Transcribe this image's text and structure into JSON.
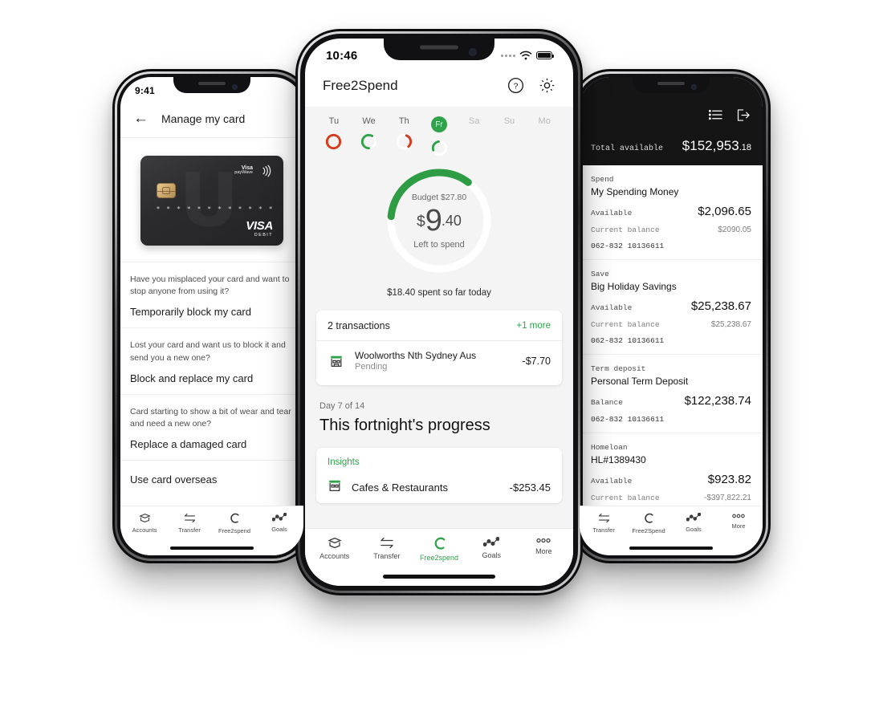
{
  "left_phone": {
    "status": {
      "time": "9:41"
    },
    "header": {
      "back_icon": "arrow-left-icon",
      "title": "Manage my card"
    },
    "card": {
      "brand_top": "Visa",
      "brand_top_sub": "payWave",
      "masked_number": "* * * *   * * * *   * * * *",
      "network": "VISA",
      "network_sub": "DEBIT",
      "logo_letter": "U"
    },
    "options": [
      {
        "question": "Have you misplaced your card and want to stop anyone from using it?",
        "action": "Temporarily block my card"
      },
      {
        "question": "Lost your card and want us to block it and send you a new one?",
        "action": "Block and replace my card"
      },
      {
        "question": "Card starting to show a bit of wear and tear and need a new one?",
        "action": "Replace a damaged card"
      }
    ],
    "simple_option": "Use card overseas",
    "tabs": [
      {
        "label": "Accounts",
        "icon": "accounts-icon",
        "active": false
      },
      {
        "label": "Transfer",
        "icon": "transfer-icon",
        "active": false
      },
      {
        "label": "Free2spend",
        "icon": "free2spend-icon",
        "active": false
      },
      {
        "label": "Goals",
        "icon": "goals-icon",
        "active": false
      }
    ]
  },
  "center_phone": {
    "status": {
      "time": "10:46",
      "wifi_icon": "wifi-icon",
      "battery_icon": "battery-icon"
    },
    "header": {
      "title": "Free2Spend",
      "help_icon": "help-circle-icon",
      "settings_icon": "gear-icon"
    },
    "days": [
      {
        "label": "Tu",
        "state": "past",
        "ring_color": "#d8391b",
        "ring_pct": 100
      },
      {
        "label": "We",
        "state": "past",
        "ring_color": "#2fa24a",
        "ring_pct": 58
      },
      {
        "label": "Th",
        "state": "past",
        "ring_color": "#d8391b",
        "ring_pct": 33
      },
      {
        "label": "Fr",
        "state": "active",
        "ring_color": "#2fa24a",
        "ring_pct": 28
      },
      {
        "label": "Sa",
        "state": "future",
        "ring_color": "",
        "ring_pct": 0
      },
      {
        "label": "Su",
        "state": "future",
        "ring_color": "",
        "ring_pct": 0
      },
      {
        "label": "Mo",
        "state": "future",
        "ring_color": "",
        "ring_pct": 0
      }
    ],
    "gauge": {
      "budget_label": "Budget $27.80",
      "currency": "$",
      "amount_major": "9",
      "amount_cents": ".40",
      "caption": "Left to spend",
      "percent": 34,
      "color": "#2e9c45",
      "track_color": "#ffffff"
    },
    "spent_today": "$18.40 spent so far today",
    "transactions_card": {
      "count_label": "2 transactions",
      "more_label": "+1 more",
      "rows": [
        {
          "icon": "store-icon",
          "name": "Woolworths Nth Sydney Aus",
          "status": "Pending",
          "amount": "-$7.70"
        }
      ]
    },
    "progress": {
      "day_label": "Day 7 of 14",
      "title": "This fortnight's progress"
    },
    "insights": {
      "label": "Insights",
      "rows": [
        {
          "icon": "store-icon",
          "name": "Cafes & Restaurants",
          "amount": "-$253.45"
        }
      ]
    },
    "tabs": [
      {
        "label": "Accounts",
        "icon": "accounts-icon",
        "active": false
      },
      {
        "label": "Transfer",
        "icon": "transfer-icon",
        "active": false
      },
      {
        "label": "Free2spend",
        "icon": "free2spend-icon",
        "active": true
      },
      {
        "label": "Goals",
        "icon": "goals-icon",
        "active": false
      },
      {
        "label": "More",
        "icon": "more-icon",
        "active": false
      }
    ]
  },
  "right_phone": {
    "icons": {
      "list_icon": "list-icon",
      "logout_icon": "logout-icon"
    },
    "total": {
      "label": "Total available",
      "value": "$152,953",
      "cents": ".18"
    },
    "accounts": [
      {
        "type": "Spend",
        "name": "My Spending Money",
        "available_label": "Available",
        "available": "$2,096.65",
        "balance_label": "Current balance",
        "balance": "$2090.05",
        "number": "062-832 10136611"
      },
      {
        "type": "Save",
        "name": "Big Holiday Savings",
        "available_label": "Available",
        "available": "$25,238.67",
        "balance_label": "Current balance",
        "balance": "$25,238.67",
        "number": "062-832 10136611"
      },
      {
        "type": "Term deposit",
        "name": "Personal Term Deposit",
        "available_label": "Balance",
        "available": "$122,238.74",
        "balance_label": "",
        "balance": "",
        "number": "062-832 10136611"
      },
      {
        "type": "Homeloan",
        "name": "HL#1389430",
        "available_label": "Available",
        "available": "$923.82",
        "balance_label": "Current balance",
        "balance": "-$397,822.21",
        "number": ""
      }
    ],
    "tabs": [
      {
        "label": "Transfer",
        "icon": "transfer-icon",
        "active": false
      },
      {
        "label": "Free2Spend",
        "icon": "free2spend-icon",
        "active": false
      },
      {
        "label": "Goals",
        "icon": "goals-icon",
        "active": false
      },
      {
        "label": "More",
        "icon": "more-icon",
        "active": false
      }
    ]
  },
  "theme": {
    "green": "#2fa24a",
    "red": "#d8391b",
    "dark": "#151515",
    "page_bg": "#f4f4f4"
  }
}
